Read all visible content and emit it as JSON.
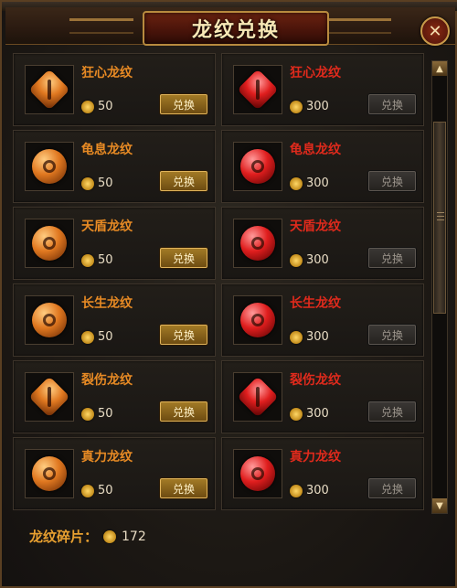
{
  "window": {
    "title": "龙纹兑换"
  },
  "items": [
    {
      "name": "狂心龙纹",
      "cost": "50",
      "button": "兑换",
      "tier": "orange",
      "shape": "diamond",
      "icon": "sword-emblem"
    },
    {
      "name": "狂心龙纹",
      "cost": "300",
      "button": "兑换",
      "tier": "red",
      "shape": "diamond",
      "icon": "sword-emblem"
    },
    {
      "name": "龟息龙纹",
      "cost": "50",
      "button": "兑换",
      "tier": "orange",
      "shape": "round",
      "icon": "shield-emblem"
    },
    {
      "name": "龟息龙纹",
      "cost": "300",
      "button": "兑换",
      "tier": "red",
      "shape": "round",
      "icon": "shield-emblem"
    },
    {
      "name": "天盾龙纹",
      "cost": "50",
      "button": "兑换",
      "tier": "orange",
      "shape": "round",
      "icon": "tower-shield-emblem"
    },
    {
      "name": "天盾龙纹",
      "cost": "300",
      "button": "兑换",
      "tier": "red",
      "shape": "round",
      "icon": "tower-shield-emblem"
    },
    {
      "name": "长生龙纹",
      "cost": "50",
      "button": "兑换",
      "tier": "orange",
      "shape": "round",
      "icon": "heart-emblem"
    },
    {
      "name": "长生龙纹",
      "cost": "300",
      "button": "兑换",
      "tier": "red",
      "shape": "round",
      "icon": "heart-emblem"
    },
    {
      "name": "裂伤龙纹",
      "cost": "50",
      "button": "兑换",
      "tier": "orange",
      "shape": "diamond",
      "icon": "axe-emblem"
    },
    {
      "name": "裂伤龙纹",
      "cost": "300",
      "button": "兑换",
      "tier": "red",
      "shape": "diamond",
      "icon": "axe-emblem"
    },
    {
      "name": "真力龙纹",
      "cost": "50",
      "button": "兑换",
      "tier": "orange",
      "shape": "round",
      "icon": "power-emblem"
    },
    {
      "name": "真力龙纹",
      "cost": "300",
      "button": "兑换",
      "tier": "red",
      "shape": "round",
      "icon": "power-emblem"
    }
  ],
  "footer": {
    "label": "龙纹碎片：",
    "value": "172"
  },
  "colors": {
    "orange_name": "#e78a24",
    "red_name": "#e02a1c",
    "label": "#e8a030"
  }
}
